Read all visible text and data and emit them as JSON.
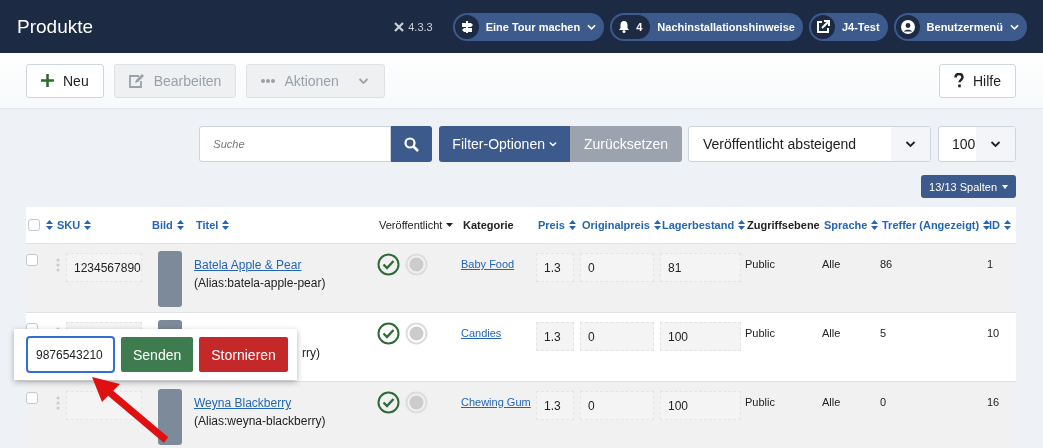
{
  "header": {
    "title": "Produkte",
    "version": "4.3.3",
    "buttons": [
      {
        "kind": "tour",
        "label": "Eine Tour machen",
        "dropdown": true
      },
      {
        "kind": "notifications",
        "count": "4",
        "label": "Nachinstallationshinweise",
        "dropdown": false
      },
      {
        "kind": "site",
        "label": "J4-Test",
        "dropdown": false
      },
      {
        "kind": "user",
        "label": "Benutzermenü",
        "dropdown": true
      }
    ]
  },
  "toolbar": {
    "buttons": [
      {
        "kind": "new",
        "label": "Neu",
        "disabled": false,
        "dropdown": false
      },
      {
        "kind": "edit",
        "label": "Bearbeiten",
        "disabled": true,
        "dropdown": false
      },
      {
        "kind": "actions",
        "label": "Aktionen",
        "disabled": true,
        "dropdown": true
      }
    ],
    "help": "Hilfe"
  },
  "filters": {
    "search": {
      "placeholder": "Suche"
    },
    "filter_button": "Filter-Optionen",
    "reset_button": "Zurücksetzen",
    "ordering": "Veröffentlicht absteigend",
    "limit": "100",
    "columns_button": "13/13 Spalten"
  },
  "table": {
    "columns": [
      {
        "label": "SKU",
        "sortable": true,
        "sorted": false
      },
      {
        "label": "Bild",
        "sortable": true,
        "sorted": false
      },
      {
        "label": "Titel",
        "sortable": true,
        "sorted": false
      },
      {
        "label": "Veröffentlicht",
        "sortable": true,
        "sorted": true
      },
      {
        "label": "Kategorie",
        "sortable": false
      },
      {
        "label": "Preis",
        "sortable": true,
        "sorted": false
      },
      {
        "label": "Originalpreis",
        "sortable": true,
        "sorted": false
      },
      {
        "label": "Lagerbestand",
        "sortable": true,
        "sorted": false
      },
      {
        "label": "Zugriffsebene",
        "sortable": false
      },
      {
        "label": "Sprache",
        "sortable": true,
        "sorted": false
      },
      {
        "label": "Treffer (Angezeigt)",
        "sortable": true,
        "sorted": false
      },
      {
        "label": "ID",
        "sortable": true,
        "sorted": false
      }
    ],
    "select_all_checked": false,
    "rows": [
      {
        "selected": false,
        "sku": "1234567890",
        "title": "Batela Apple & Pear",
        "alias": "(Alias:batela-apple-pear)",
        "published": true,
        "featured": false,
        "category": "Baby Food",
        "price": "1.3",
        "original_price": "0",
        "stock": "81",
        "access": "Public",
        "language": "Alle",
        "hits": "86",
        "id": "1"
      },
      {
        "selected": false,
        "alias": "rry)",
        "published": true,
        "featured": false,
        "category": "Candies",
        "price": "1.3",
        "original_price": "0",
        "stock": "100",
        "access": "Public",
        "language": "Alle",
        "hits": "5",
        "id": "10"
      },
      {
        "selected": false,
        "title": "Weyna Blackberry",
        "alias": "(Alias:weyna-blackberry)",
        "published": true,
        "featured": false,
        "category": "Chewing Gum",
        "price": "1.3",
        "original_price": "0",
        "stock": "100",
        "access": "Public",
        "language": "Alle",
        "hits": "0",
        "id": "16"
      }
    ]
  },
  "sku_editor": {
    "value": "9876543210",
    "buttons": [
      {
        "kind": "submit",
        "label": "Senden"
      },
      {
        "kind": "cancel",
        "label": "Stornieren"
      }
    ]
  }
}
